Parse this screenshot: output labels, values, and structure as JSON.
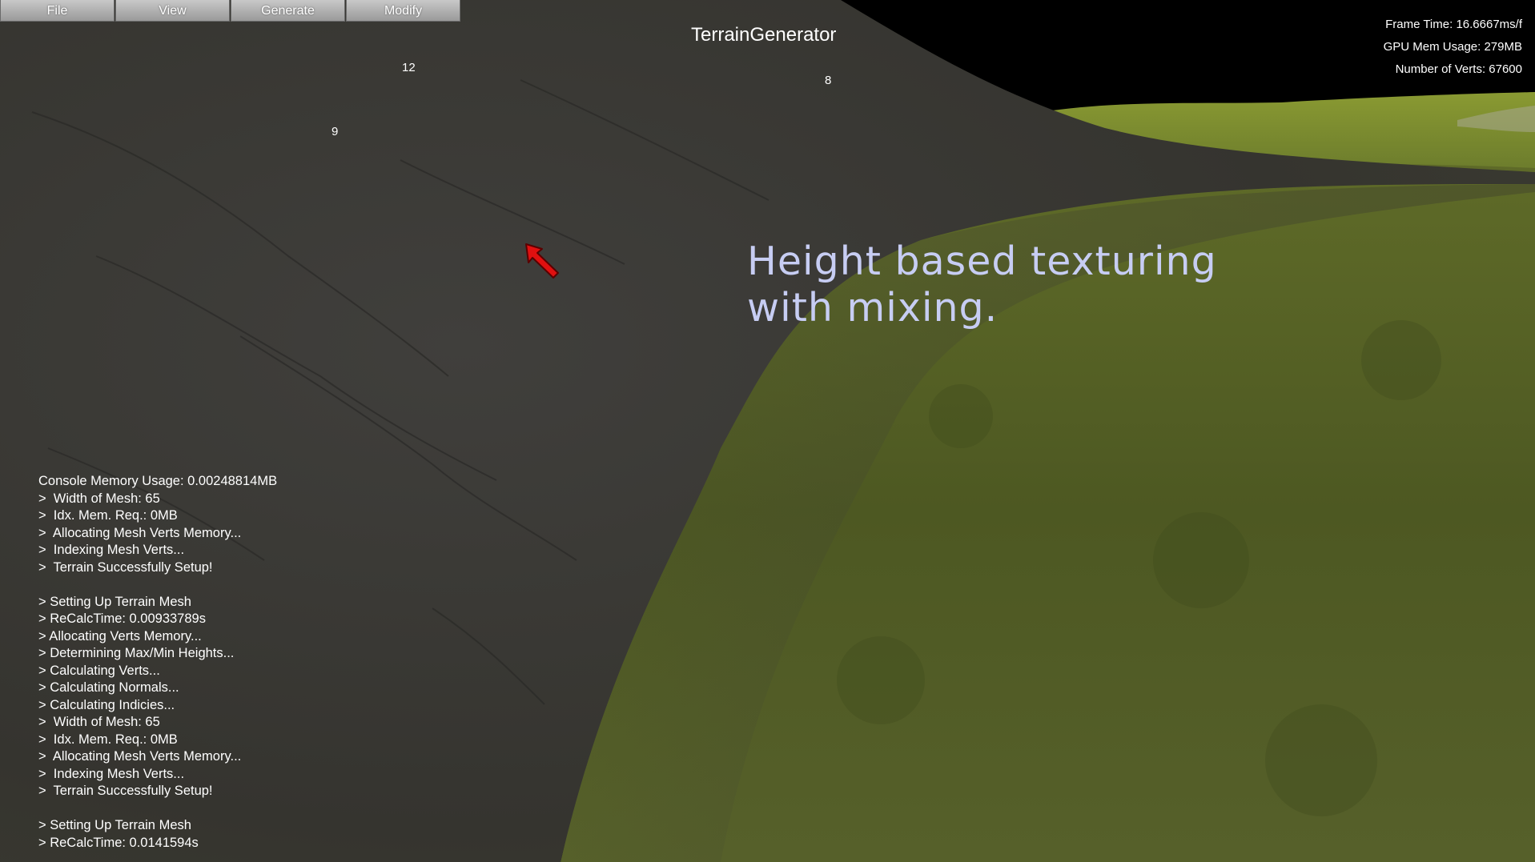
{
  "menu": {
    "items": [
      {
        "label": "File"
      },
      {
        "label": "View"
      },
      {
        "label": "Generate"
      },
      {
        "label": "Modify"
      }
    ]
  },
  "app_title": "TerrainGenerator",
  "stats": {
    "frame_time": "Frame Time: 16.6667ms/f",
    "gpu_mem": "GPU Mem Usage: 279MB",
    "verts": "Number of Verts: 67600"
  },
  "markers": [
    "12",
    "8",
    "9"
  ],
  "caption": {
    "line1": "Height based texturing",
    "line2": "with mixing."
  },
  "console": {
    "header": "Console Memory Usage: 0.00248814MB",
    "lines": [
      ">  Width of Mesh: 65",
      ">  Idx. Mem. Req.: 0MB",
      ">  Allocating Mesh Verts Memory...",
      ">  Indexing Mesh Verts...",
      ">  Terrain Successfully Setup!",
      "",
      "> Setting Up Terrain Mesh",
      "> ReCalcTime: 0.00933789s",
      "> Allocating Verts Memory...",
      "> Determining Max/Min Heights...",
      "> Calculating Verts...",
      "> Calculating Normals...",
      "> Calculating Indicies...",
      ">  Width of Mesh: 65",
      ">  Idx. Mem. Req.: 0MB",
      ">  Allocating Mesh Verts Memory...",
      ">  Indexing Mesh Verts...",
      ">  Terrain Successfully Setup!",
      "",
      "> Setting Up Terrain Mesh",
      "> ReCalcTime: 0.0141594s"
    ]
  },
  "colors": {
    "sky": "#000000",
    "rock": "#3a3937",
    "grass": "#4f5a22",
    "caption": "#c7cdf3",
    "cursor": "#e01010"
  },
  "icons": {
    "cursor": "red-arrow-cursor-icon"
  }
}
